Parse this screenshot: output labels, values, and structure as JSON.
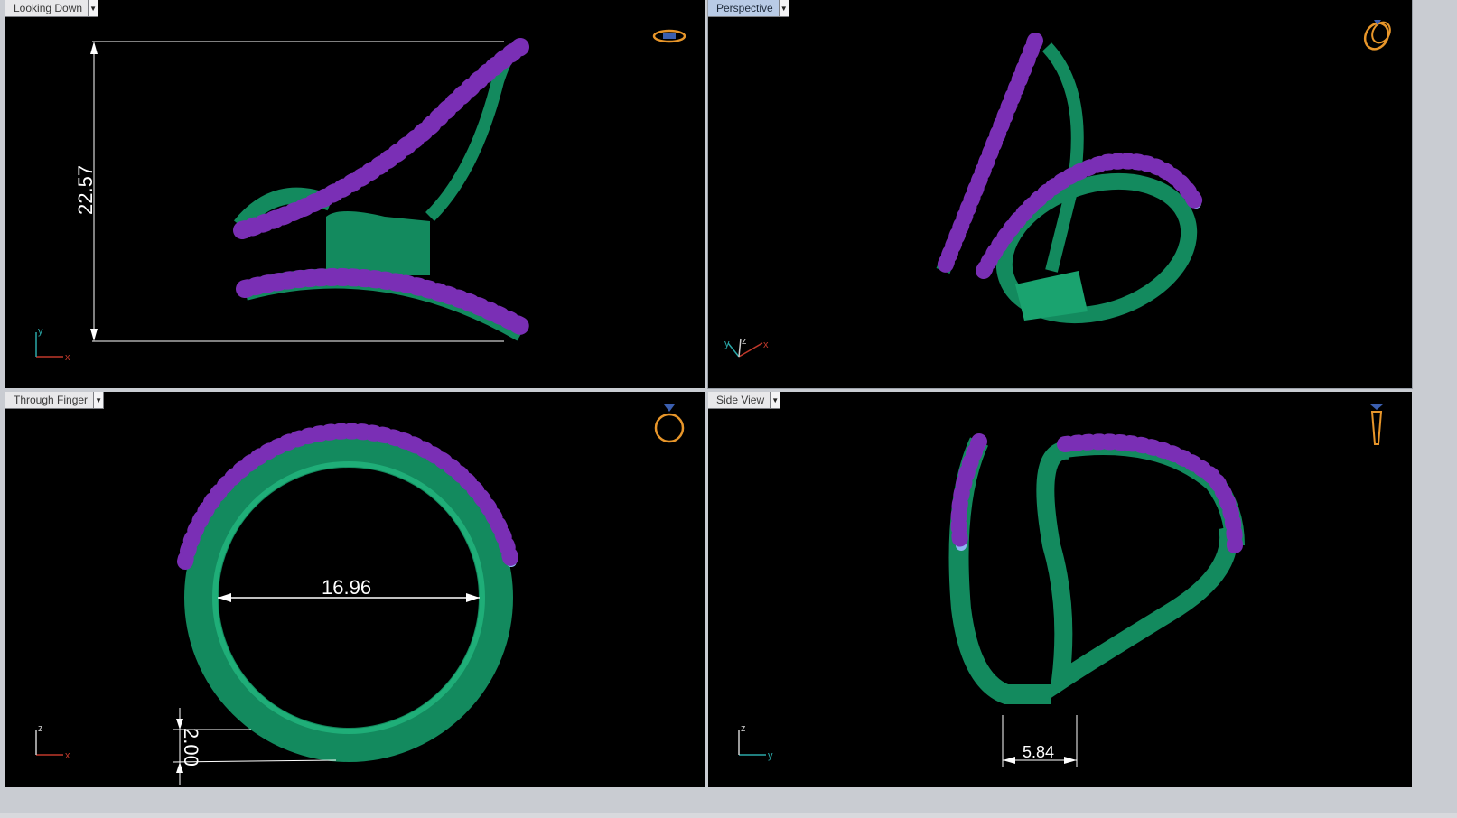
{
  "viewports": [
    {
      "id": "top",
      "title": "Looking Down",
      "active": false,
      "axes": {
        "h": "x",
        "v": "y"
      },
      "dimension": "22.57"
    },
    {
      "id": "perspective",
      "title": "Perspective",
      "active": true,
      "axes": {
        "a": "y",
        "b": "z",
        "c": "x"
      }
    },
    {
      "id": "front",
      "title": "Through Finger",
      "active": false,
      "axes": {
        "h": "x",
        "v": "z"
      },
      "dimension": "16.96",
      "dimension2": "2.00"
    },
    {
      "id": "side",
      "title": "Side View",
      "active": false,
      "axes": {
        "h": "y",
        "v": "z"
      },
      "dimension": "5.84"
    }
  ],
  "colors": {
    "metal": "#138a5e",
    "metal_light": "#2fd39a",
    "gem": "#8fb4f4",
    "prong": "#7a2fb5",
    "nav_icon": "#e8962a",
    "axis_x": "#c0392b",
    "axis_y": "#2aa8a8",
    "axis_z": "#cfcfcf"
  },
  "icons": [
    "ring-top-view-icon",
    "ring-perspective-icon",
    "ring-front-view-icon",
    "ring-side-view-icon"
  ]
}
